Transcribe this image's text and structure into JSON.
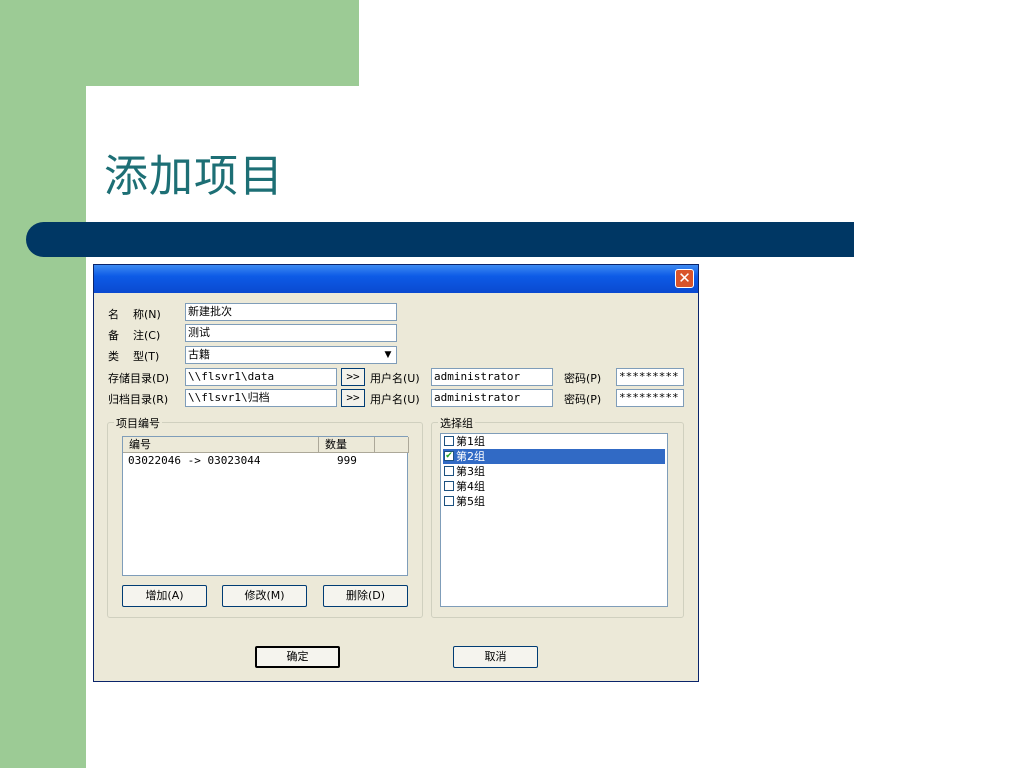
{
  "slide": {
    "title": "添加项目"
  },
  "dialog": {
    "close_icon": "✕",
    "form": {
      "name": {
        "label": "名    称(N)",
        "value": "新建批次"
      },
      "note": {
        "label": "备    注(C)",
        "value": "测试"
      },
      "type": {
        "label": "类    型(T)",
        "value": "古籍",
        "dropdown_icon": "▼"
      },
      "storage": {
        "label": "存储目录(D)",
        "path": "\\\\flsvr1\\data",
        "browse": ">>",
        "user_label": "用户名(U)",
        "user": "administrator",
        "pwd_label": "密码(P)",
        "pwd": "*********"
      },
      "archive": {
        "label": "归档目录(R)",
        "path": "\\\\flsvr1\\归档",
        "browse": ">>",
        "user_label": "用户名(U)",
        "user": "administrator",
        "pwd_label": "密码(P)",
        "pwd": "*********"
      }
    },
    "project_group": {
      "title": "项目编号",
      "columns": [
        "编号",
        "数量"
      ],
      "rows": [
        {
          "id": "03022046 -> 03023044",
          "qty": "999"
        }
      ],
      "buttons": {
        "add": "增加(A)",
        "edit": "修改(M)",
        "delete": "删除(D)"
      }
    },
    "select_group": {
      "title": "选择组",
      "check_mark": "✔",
      "items": [
        {
          "label": "第1组",
          "checked": false,
          "selected": false
        },
        {
          "label": "第2组",
          "checked": true,
          "selected": true
        },
        {
          "label": "第3组",
          "checked": false,
          "selected": false
        },
        {
          "label": "第4组",
          "checked": false,
          "selected": false
        },
        {
          "label": "第5组",
          "checked": false,
          "selected": false
        }
      ]
    },
    "footer": {
      "ok": "确定",
      "cancel": "取消"
    }
  }
}
